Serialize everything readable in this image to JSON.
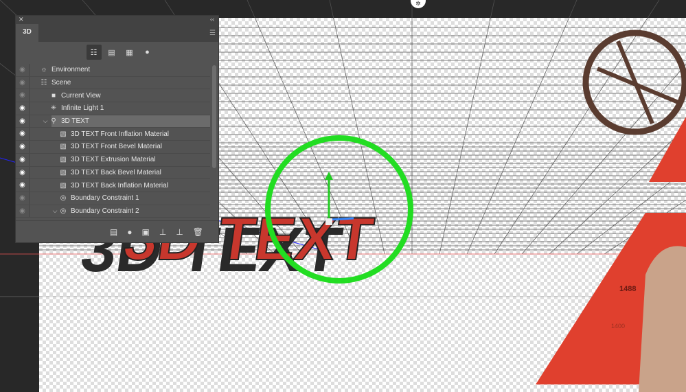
{
  "panel": {
    "title": "3D",
    "close_icon": "close-icon",
    "collapse_icon": "double-chevron-icon",
    "filters": [
      {
        "icon": "scene-filter-icon",
        "active": true
      },
      {
        "icon": "mesh-filter-icon"
      },
      {
        "icon": "material-filter-icon"
      },
      {
        "icon": "light-filter-icon"
      }
    ],
    "items": [
      {
        "label": "Environment",
        "icon": "environment-icon",
        "visible": false,
        "indent": 0
      },
      {
        "label": "Scene",
        "icon": "scene-icon",
        "visible": false,
        "indent": 0
      },
      {
        "label": "Current View",
        "icon": "camera-icon",
        "visible": false,
        "indent": 1
      },
      {
        "label": "Infinite Light 1",
        "icon": "light-icon",
        "visible": true,
        "indent": 1
      },
      {
        "label": "3D TEXT",
        "icon": "mesh-icon",
        "visible": true,
        "indent": 1,
        "selected": true,
        "expanded": true
      },
      {
        "label": "3D TEXT Front Inflation Material",
        "icon": "material-icon",
        "visible": true,
        "indent": 2
      },
      {
        "label": "3D TEXT Front Bevel Material",
        "icon": "material-icon",
        "visible": true,
        "indent": 2
      },
      {
        "label": "3D TEXT Extrusion Material",
        "icon": "material-icon",
        "visible": true,
        "indent": 2
      },
      {
        "label": "3D TEXT Back Bevel Material",
        "icon": "material-icon",
        "visible": true,
        "indent": 2
      },
      {
        "label": "3D TEXT Back Inflation Material",
        "icon": "material-icon",
        "visible": true,
        "indent": 2
      },
      {
        "label": "Boundary Constraint 1",
        "icon": "constraint-icon",
        "visible": false,
        "indent": 2
      },
      {
        "label": "Boundary Constraint 2",
        "icon": "constraint-icon",
        "visible": false,
        "indent": 2,
        "expanded": true
      }
    ],
    "bottom_buttons": [
      "add-mesh-icon",
      "add-light-icon",
      "render-icon",
      "ground-icon",
      "drop-to-plane-icon",
      "trash-icon"
    ]
  },
  "canvas": {
    "text3d": "3D TEXT",
    "map_elevation": "1488",
    "map_contour": "1400",
    "highlight_color": "#22dd22",
    "text_color": "#c8372d"
  }
}
